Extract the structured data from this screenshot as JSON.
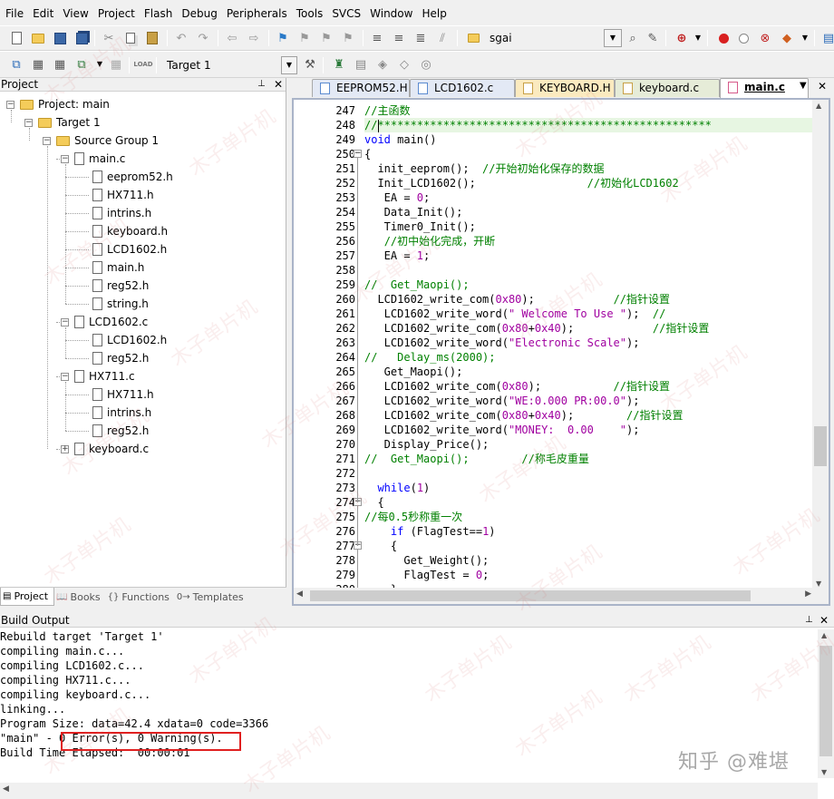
{
  "menus": [
    "File",
    "Edit",
    "View",
    "Project",
    "Flash",
    "Debug",
    "Peripherals",
    "Tools",
    "SVCS",
    "Window",
    "Help"
  ],
  "toolbar1": {
    "search_combo_value": "sgai"
  },
  "toolbar2": {
    "target_combo_value": "Target 1"
  },
  "project_panel": {
    "title": "Project",
    "tree": {
      "project": "Project: main",
      "target": "Target 1",
      "group": "Source Group 1",
      "files": [
        {
          "name": "main.c",
          "children": [
            "eeprom52.h",
            "HX711.h",
            "intrins.h",
            "keyboard.h",
            "LCD1602.h",
            "main.h",
            "reg52.h",
            "string.h"
          ]
        },
        {
          "name": "LCD1602.c",
          "children": [
            "LCD1602.h",
            "reg52.h"
          ]
        },
        {
          "name": "HX711.c",
          "children": [
            "HX711.h",
            "intrins.h",
            "reg52.h"
          ]
        },
        {
          "name": "keyboard.c",
          "children": []
        }
      ]
    },
    "tabs": [
      "Project",
      "Books",
      "Functions",
      "Templates"
    ]
  },
  "editor": {
    "tabs": [
      "EEPROM52.H",
      "LCD1602.c",
      "KEYBOARD.H",
      "keyboard.c",
      "main.c"
    ],
    "active_tab": "main.c",
    "line_numbers": [
      "247",
      "248",
      "249",
      "250",
      "251",
      "252",
      "253",
      "254",
      "255",
      "256",
      "257",
      "258",
      "259",
      "260",
      "261",
      "262",
      "263",
      "264",
      "265",
      "266",
      "267",
      "268",
      "269",
      "270",
      "271",
      "272",
      "273",
      "274",
      "275",
      "276",
      "277",
      "278",
      "279",
      "280"
    ],
    "lines": [
      [
        {
          "t": "//主函数",
          "c": "cm"
        }
      ],
      [
        {
          "t": "//***************************************************",
          "c": "cm"
        }
      ],
      [
        {
          "t": "void",
          "c": "kw"
        },
        {
          "t": " main()",
          "c": ""
        }
      ],
      [
        {
          "t": "{",
          "c": ""
        }
      ],
      [
        {
          "t": "  init_eeprom();  ",
          "c": ""
        },
        {
          "t": "//开始初始化保存的数据",
          "c": "cm"
        }
      ],
      [
        {
          "t": "  Init_LCD1602();                 ",
          "c": ""
        },
        {
          "t": "//初始化LCD1602",
          "c": "cm"
        }
      ],
      [
        {
          "t": "   EA = ",
          "c": ""
        },
        {
          "t": "0",
          "c": "nm"
        },
        {
          "t": ";",
          "c": ""
        }
      ],
      [
        {
          "t": "   Data_Init();",
          "c": ""
        }
      ],
      [
        {
          "t": "   Timer0_Init();",
          "c": ""
        }
      ],
      [
        {
          "t": "   ",
          "c": ""
        },
        {
          "t": "//初中始化完成，开断",
          "c": "cm"
        }
      ],
      [
        {
          "t": "   EA = ",
          "c": ""
        },
        {
          "t": "1",
          "c": "nm"
        },
        {
          "t": ";",
          "c": ""
        }
      ],
      [
        {
          "t": "",
          "c": ""
        }
      ],
      [
        {
          "t": "//  Get_Maopi();",
          "c": "cm"
        }
      ],
      [
        {
          "t": "  LCD1602_write_com(",
          "c": ""
        },
        {
          "t": "0x80",
          "c": "nm"
        },
        {
          "t": ");            ",
          "c": ""
        },
        {
          "t": "//指针设置",
          "c": "cm"
        }
      ],
      [
        {
          "t": "   LCD1602_write_word(",
          "c": ""
        },
        {
          "t": "\" Welcome To Use \"",
          "c": "st"
        },
        {
          "t": ");  ",
          "c": ""
        },
        {
          "t": "//",
          "c": "cm"
        }
      ],
      [
        {
          "t": "   LCD1602_write_com(",
          "c": ""
        },
        {
          "t": "0x80",
          "c": "nm"
        },
        {
          "t": "+",
          "c": ""
        },
        {
          "t": "0x40",
          "c": "nm"
        },
        {
          "t": ");            ",
          "c": ""
        },
        {
          "t": "//指针设置",
          "c": "cm"
        }
      ],
      [
        {
          "t": "   LCD1602_write_word(",
          "c": ""
        },
        {
          "t": "\"Electronic Scale\"",
          "c": "st"
        },
        {
          "t": ");",
          "c": ""
        }
      ],
      [
        {
          "t": "//   Delay_ms(2000);",
          "c": "cm"
        }
      ],
      [
        {
          "t": "   Get_Maopi();",
          "c": ""
        }
      ],
      [
        {
          "t": "   LCD1602_write_com(",
          "c": ""
        },
        {
          "t": "0x80",
          "c": "nm"
        },
        {
          "t": ");           ",
          "c": ""
        },
        {
          "t": "//指针设置",
          "c": "cm"
        }
      ],
      [
        {
          "t": "   LCD1602_write_word(",
          "c": ""
        },
        {
          "t": "\"WE:0.000 PR:00.0\"",
          "c": "st"
        },
        {
          "t": ");",
          "c": ""
        }
      ],
      [
        {
          "t": "   LCD1602_write_com(",
          "c": ""
        },
        {
          "t": "0x80",
          "c": "nm"
        },
        {
          "t": "+",
          "c": ""
        },
        {
          "t": "0x40",
          "c": "nm"
        },
        {
          "t": ");        ",
          "c": ""
        },
        {
          "t": "//指针设置",
          "c": "cm"
        }
      ],
      [
        {
          "t": "   LCD1602_write_word(",
          "c": ""
        },
        {
          "t": "\"MONEY:  0.00    \"",
          "c": "st"
        },
        {
          "t": ");",
          "c": ""
        }
      ],
      [
        {
          "t": "   Display_Price();",
          "c": ""
        }
      ],
      [
        {
          "t": "//  Get_Maopi();        ",
          "c": "cm"
        },
        {
          "t": "//称毛皮重量",
          "c": "cm"
        }
      ],
      [
        {
          "t": "",
          "c": ""
        }
      ],
      [
        {
          "t": "  ",
          "c": ""
        },
        {
          "t": "while",
          "c": "kw"
        },
        {
          "t": "(",
          "c": ""
        },
        {
          "t": "1",
          "c": "nm"
        },
        {
          "t": ")",
          "c": ""
        }
      ],
      [
        {
          "t": "  {",
          "c": ""
        }
      ],
      [
        {
          "t": "//每0.5秒称重一次",
          "c": "cm"
        }
      ],
      [
        {
          "t": "    ",
          "c": ""
        },
        {
          "t": "if",
          "c": "kw"
        },
        {
          "t": " (FlagTest==",
          "c": ""
        },
        {
          "t": "1",
          "c": "nm"
        },
        {
          "t": ")",
          "c": ""
        }
      ],
      [
        {
          "t": "    {",
          "c": ""
        }
      ],
      [
        {
          "t": "      Get_Weight();",
          "c": ""
        }
      ],
      [
        {
          "t": "      FlagTest = ",
          "c": ""
        },
        {
          "t": "0",
          "c": "nm"
        },
        {
          "t": ";",
          "c": ""
        }
      ],
      [
        {
          "t": "    }",
          "c": ""
        }
      ]
    ]
  },
  "build_output": {
    "title": "Build Output",
    "lines": [
      "Rebuild target 'Target 1'",
      "compiling main.c...",
      "compiling LCD1602.c...",
      "compiling HX711.c...",
      "compiling keyboard.c...",
      "linking...",
      "Program Size: data=42.4 xdata=0 code=3366",
      "\"main\" - 0 Error(s), 0 Warning(s).",
      "Build Time Elapsed:  00:00:01"
    ]
  },
  "watermark": {
    "text": "木子单片机",
    "credit": "知乎 @难堪"
  },
  "colors": {
    "comment": "#008000",
    "keyword": "#0000ff",
    "string": "#a000a0",
    "highlight": "#e7f6e2",
    "error_box": "#e02020"
  }
}
